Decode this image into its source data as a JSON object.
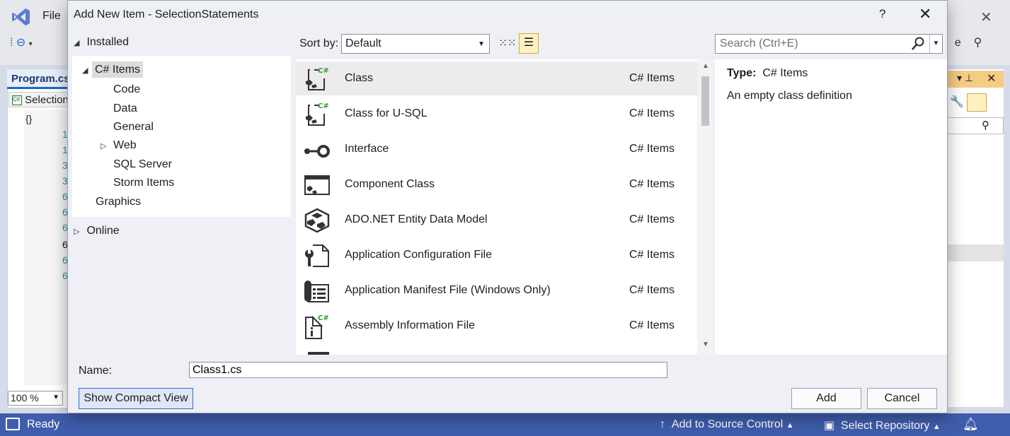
{
  "ide": {
    "menu_file": "File",
    "editor_tab": "Program.cs",
    "nav_dropdown": "SelectionStatements",
    "line_numbers": [
      "1",
      "1",
      "3",
      "3",
      "6",
      "6",
      "6",
      "6",
      "6",
      "6"
    ],
    "zoom": "100 %",
    "status": {
      "ready": "Ready",
      "add_to_source_control": "Add to Source Control",
      "select_repository": "Select Repository"
    }
  },
  "dialog": {
    "title": "Add New Item - SelectionStatements",
    "help": "?",
    "installed_label": "Installed",
    "tree": [
      {
        "label": "C# Items",
        "selected": true
      },
      {
        "label": "Code"
      },
      {
        "label": "Data"
      },
      {
        "label": "General"
      },
      {
        "label": "Web"
      },
      {
        "label": "SQL Server"
      },
      {
        "label": "Storm Items"
      },
      {
        "label": "Graphics"
      }
    ],
    "online_label": "Online",
    "sort_label": "Sort by:",
    "sort_value": "Default",
    "search_placeholder": "Search (Ctrl+E)",
    "items": [
      {
        "name": "Class",
        "type": "C# Items",
        "icon": "class-icon"
      },
      {
        "name": "Class for U-SQL",
        "type": "C# Items",
        "icon": "class-usql-icon"
      },
      {
        "name": "Interface",
        "type": "C# Items",
        "icon": "interface-icon"
      },
      {
        "name": "Component Class",
        "type": "C# Items",
        "icon": "component-class-icon"
      },
      {
        "name": "ADO.NET Entity Data Model",
        "type": "C# Items",
        "icon": "entity-data-model-icon"
      },
      {
        "name": "Application Configuration File",
        "type": "C# Items",
        "icon": "config-file-icon"
      },
      {
        "name": "Application Manifest File (Windows Only)",
        "type": "C# Items",
        "icon": "manifest-file-icon"
      },
      {
        "name": "Assembly Information File",
        "type": "C# Items",
        "icon": "assembly-info-icon"
      }
    ],
    "detail": {
      "type_label": "Type:",
      "type_value": "C# Items",
      "description": "An empty class definition"
    },
    "name_label": "Name:",
    "name_value": "Class1.cs",
    "compact_button": "Show Compact View",
    "add_button": "Add",
    "cancel_button": "Cancel",
    "accent_color": "#2f6bd1",
    "csharp_badge": "C#"
  }
}
